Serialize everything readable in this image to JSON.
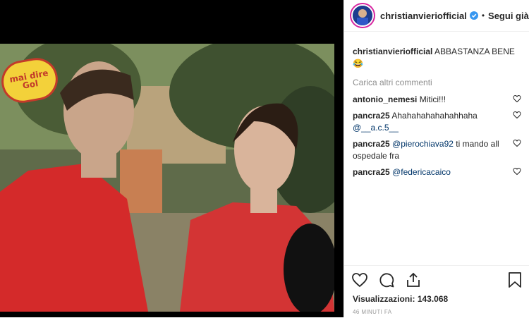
{
  "post": {
    "username": "christianvieriofficial",
    "separator": "•",
    "follow_label": "Segui già"
  },
  "video": {
    "overlay_logo_text": "mai dire Gol"
  },
  "caption": {
    "username": "christianvieriofficial",
    "text": "ABBASTANZA BENE",
    "emoji": "😂"
  },
  "load_more_label": "Carica altri commenti",
  "comments": [
    {
      "username": "antonio_nemesi",
      "text": "Mitici!!!",
      "mention": ""
    },
    {
      "username": "pancra25",
      "text": "Ahahahahahahahhaha",
      "mention": "@__a.c.5__"
    },
    {
      "username": "pancra25",
      "text": "ti mando all ospedale fra",
      "mention": "@pierochiava92"
    },
    {
      "username": "pancra25",
      "text": "",
      "mention": "@federicacaico"
    }
  ],
  "stats": {
    "views_label": "Visualizzazioni:",
    "views_count": "143.068",
    "time": "46 MINUTI FA"
  },
  "icons": {
    "like": "heart-icon",
    "comment": "comment-icon",
    "share": "share-icon",
    "save": "bookmark-icon",
    "verified": "verified-badge-icon"
  },
  "colors": {
    "mention": "#003569",
    "verified": "#3897f0",
    "muted": "#8e8e8e"
  }
}
